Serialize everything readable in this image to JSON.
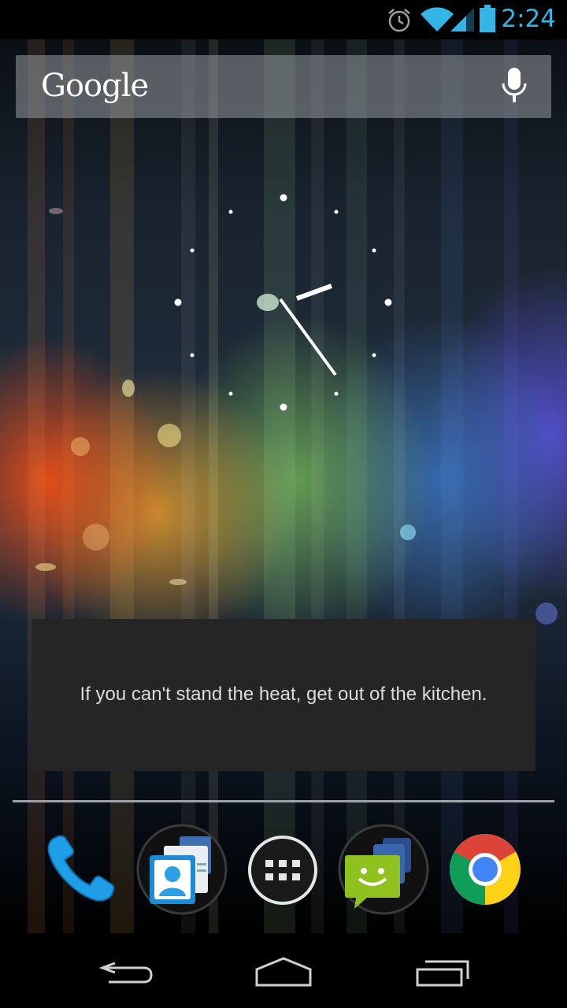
{
  "status_bar": {
    "time": "2:24",
    "icons": [
      "alarm-icon",
      "wifi-icon",
      "signal-icon",
      "battery-icon"
    ],
    "accent_color": "#33b5e5"
  },
  "search": {
    "logo_text": "Google",
    "icons": [
      "mic-icon"
    ]
  },
  "clock_widget": {
    "type": "analog-clock"
  },
  "quote_widget": {
    "text": "If you can't stand the heat, get out of the kitchen."
  },
  "dock": {
    "items": [
      {
        "name": "phone",
        "icon": "phone-icon"
      },
      {
        "name": "contacts-folder",
        "icon": "contacts-icon"
      },
      {
        "name": "all-apps",
        "icon": "apps-grid-icon"
      },
      {
        "name": "messaging-folder",
        "icon": "messaging-icon"
      },
      {
        "name": "chrome",
        "icon": "chrome-icon"
      }
    ]
  },
  "nav_bar": {
    "icons": [
      "back-icon",
      "home-icon",
      "recents-icon"
    ]
  }
}
